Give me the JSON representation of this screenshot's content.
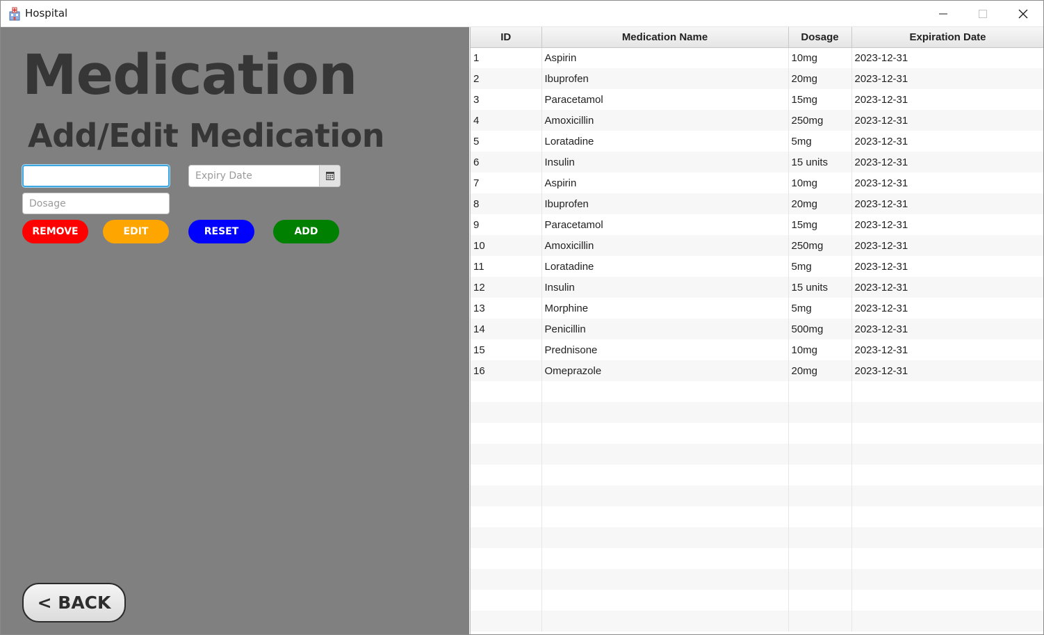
{
  "window": {
    "title": "Hospital"
  },
  "form": {
    "page_title": "Medication",
    "section_title": "Add/Edit Medication",
    "name_value": "",
    "expiry_placeholder": "Expiry Date",
    "dosage_placeholder": "Dosage",
    "buttons": {
      "remove": "REMOVE",
      "edit": "EDIT",
      "reset": "RESET",
      "add": "ADD"
    },
    "back_label": "< BACK"
  },
  "colors": {
    "remove": "#ff0000",
    "edit": "#ffa500",
    "reset": "#0000ff",
    "add": "#008000",
    "panel": "#808080"
  },
  "table": {
    "columns": [
      "ID",
      "Medication Name",
      "Dosage",
      "Expiration Date"
    ],
    "rows": [
      [
        "1",
        "Aspirin",
        "10mg",
        "2023-12-31"
      ],
      [
        "2",
        "Ibuprofen",
        "20mg",
        "2023-12-31"
      ],
      [
        "3",
        "Paracetamol",
        "15mg",
        "2023-12-31"
      ],
      [
        "4",
        "Amoxicillin",
        "250mg",
        "2023-12-31"
      ],
      [
        "5",
        "Loratadine",
        "5mg",
        "2023-12-31"
      ],
      [
        "6",
        "Insulin",
        "15 units",
        "2023-12-31"
      ],
      [
        "7",
        "Aspirin",
        "10mg",
        "2023-12-31"
      ],
      [
        "8",
        "Ibuprofen",
        "20mg",
        "2023-12-31"
      ],
      [
        "9",
        "Paracetamol",
        "15mg",
        "2023-12-31"
      ],
      [
        "10",
        "Amoxicillin",
        "250mg",
        "2023-12-31"
      ],
      [
        "11",
        "Loratadine",
        "5mg",
        "2023-12-31"
      ],
      [
        "12",
        "Insulin",
        "15 units",
        "2023-12-31"
      ],
      [
        "13",
        "Morphine",
        "5mg",
        "2023-12-31"
      ],
      [
        "14",
        "Penicillin",
        "500mg",
        "2023-12-31"
      ],
      [
        "15",
        "Prednisone",
        "10mg",
        "2023-12-31"
      ],
      [
        "16",
        "Omeprazole",
        "20mg",
        "2023-12-31"
      ]
    ]
  }
}
